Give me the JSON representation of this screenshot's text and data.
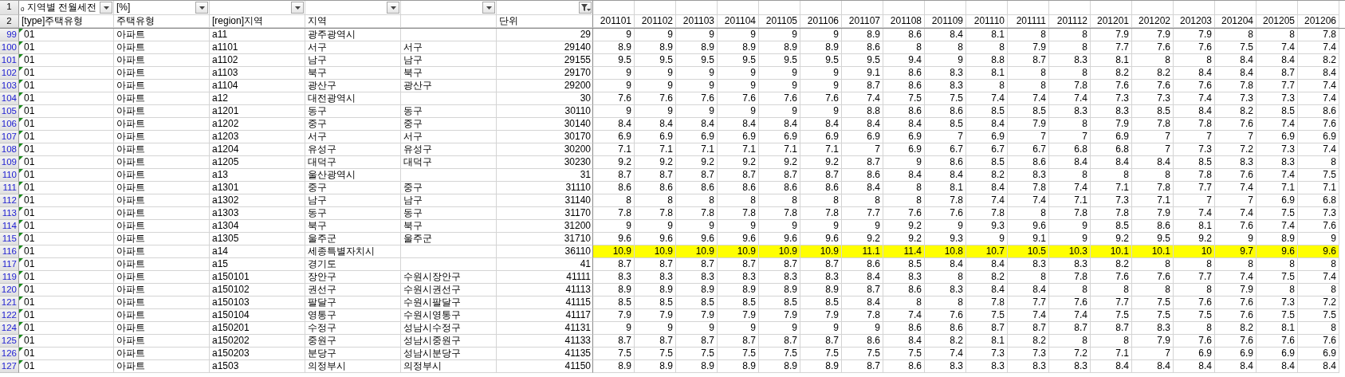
{
  "title_row": {
    "row_number": "1",
    "title": "ₒ 지역별 전월세전",
    "unit_note": "[%]",
    "filters": [
      {
        "active": false
      },
      {
        "active": false
      },
      {
        "active": false
      },
      {
        "active": false
      },
      {
        "active": false
      },
      {
        "active": true
      }
    ]
  },
  "header_row": {
    "row_number": "2",
    "type_code": "[type]주택유형",
    "type": "주택유형",
    "region_code": "[region]지역",
    "region": "지역",
    "unit": "단위",
    "months": [
      "201101",
      "201102",
      "201103",
      "201104",
      "201105",
      "201106",
      "201107",
      "201108",
      "201109",
      "201110",
      "201111",
      "201112",
      "201201",
      "201202",
      "201203",
      "201204",
      "201205",
      "201206"
    ]
  },
  "rows": [
    {
      "row_number": "99",
      "type_code": "01",
      "type": "아파트",
      "code": "a11",
      "region": "광주광역시",
      "unit": "29",
      "highlighted": false,
      "values": [
        "9",
        "9",
        "9",
        "9",
        "9",
        "9",
        "8.9",
        "8.6",
        "8.4",
        "8.1",
        "8",
        "8",
        "7.9",
        "7.9",
        "7.9",
        "8",
        "8",
        "7.8"
      ]
    },
    {
      "row_number": "100",
      "type_code": "01",
      "type": "아파트",
      "code": "a1101",
      "region": "서구",
      "region_full": "서구",
      "unit": "29140",
      "highlighted": false,
      "values": [
        "8.9",
        "8.9",
        "8.9",
        "8.9",
        "8.9",
        "8.9",
        "8.6",
        "8",
        "8",
        "8",
        "7.9",
        "8",
        "7.7",
        "7.6",
        "7.6",
        "7.5",
        "7.4",
        "7.4"
      ]
    },
    {
      "row_number": "101",
      "type_code": "01",
      "type": "아파트",
      "code": "a1102",
      "region": "남구",
      "region_full": "남구",
      "unit": "29155",
      "highlighted": false,
      "values": [
        "9.5",
        "9.5",
        "9.5",
        "9.5",
        "9.5",
        "9.5",
        "9.5",
        "9.4",
        "9",
        "8.8",
        "8.7",
        "8.3",
        "8.1",
        "8",
        "8",
        "8.4",
        "8.4",
        "8.2"
      ]
    },
    {
      "row_number": "102",
      "type_code": "01",
      "type": "아파트",
      "code": "a1103",
      "region": "북구",
      "region_full": "북구",
      "unit": "29170",
      "highlighted": false,
      "values": [
        "9",
        "9",
        "9",
        "9",
        "9",
        "9",
        "9.1",
        "8.6",
        "8.3",
        "8.1",
        "8",
        "8",
        "8.2",
        "8.2",
        "8.4",
        "8.4",
        "8.7",
        "8.4"
      ]
    },
    {
      "row_number": "103",
      "type_code": "01",
      "type": "아파트",
      "code": "a1104",
      "region": "광산구",
      "region_full": "광산구",
      "unit": "29200",
      "highlighted": false,
      "values": [
        "9",
        "9",
        "9",
        "9",
        "9",
        "9",
        "8.7",
        "8.6",
        "8.3",
        "8",
        "8",
        "7.8",
        "7.6",
        "7.6",
        "7.6",
        "7.8",
        "7.7",
        "7.4"
      ]
    },
    {
      "row_number": "104",
      "type_code": "01",
      "type": "아파트",
      "code": "a12",
      "region": "대전광역시",
      "unit": "30",
      "highlighted": false,
      "values": [
        "7.6",
        "7.6",
        "7.6",
        "7.6",
        "7.6",
        "7.6",
        "7.4",
        "7.5",
        "7.5",
        "7.4",
        "7.4",
        "7.4",
        "7.3",
        "7.3",
        "7.4",
        "7.3",
        "7.3",
        "7.4"
      ]
    },
    {
      "row_number": "105",
      "type_code": "01",
      "type": "아파트",
      "code": "a1201",
      "region": "동구",
      "region_full": "동구",
      "unit": "30110",
      "highlighted": false,
      "values": [
        "9",
        "9",
        "9",
        "9",
        "9",
        "9",
        "8.8",
        "8.6",
        "8.6",
        "8.5",
        "8.5",
        "8.3",
        "8.3",
        "8.5",
        "8.4",
        "8.2",
        "8.5",
        "8.6"
      ]
    },
    {
      "row_number": "106",
      "type_code": "01",
      "type": "아파트",
      "code": "a1202",
      "region": "중구",
      "region_full": "중구",
      "unit": "30140",
      "highlighted": false,
      "values": [
        "8.4",
        "8.4",
        "8.4",
        "8.4",
        "8.4",
        "8.4",
        "8.4",
        "8.4",
        "8.5",
        "8.4",
        "7.9",
        "8",
        "7.9",
        "7.8",
        "7.8",
        "7.6",
        "7.4",
        "7.6"
      ]
    },
    {
      "row_number": "107",
      "type_code": "01",
      "type": "아파트",
      "code": "a1203",
      "region": "서구",
      "region_full": "서구",
      "unit": "30170",
      "highlighted": false,
      "values": [
        "6.9",
        "6.9",
        "6.9",
        "6.9",
        "6.9",
        "6.9",
        "6.9",
        "6.9",
        "7",
        "6.9",
        "7",
        "7",
        "6.9",
        "7",
        "7",
        "7",
        "6.9",
        "6.9"
      ]
    },
    {
      "row_number": "108",
      "type_code": "01",
      "type": "아파트",
      "code": "a1204",
      "region": "유성구",
      "region_full": "유성구",
      "unit": "30200",
      "highlighted": false,
      "values": [
        "7.1",
        "7.1",
        "7.1",
        "7.1",
        "7.1",
        "7.1",
        "7",
        "6.9",
        "6.7",
        "6.7",
        "6.7",
        "6.8",
        "6.8",
        "7",
        "7.3",
        "7.2",
        "7.3",
        "7.4"
      ]
    },
    {
      "row_number": "109",
      "type_code": "01",
      "type": "아파트",
      "code": "a1205",
      "region": "대덕구",
      "region_full": "대덕구",
      "unit": "30230",
      "highlighted": false,
      "values": [
        "9.2",
        "9.2",
        "9.2",
        "9.2",
        "9.2",
        "9.2",
        "8.7",
        "9",
        "8.6",
        "8.5",
        "8.6",
        "8.4",
        "8.4",
        "8.4",
        "8.5",
        "8.3",
        "8.3",
        "8"
      ]
    },
    {
      "row_number": "110",
      "type_code": "01",
      "type": "아파트",
      "code": "a13",
      "region": "울산광역시",
      "unit": "31",
      "highlighted": false,
      "values": [
        "8.7",
        "8.7",
        "8.7",
        "8.7",
        "8.7",
        "8.7",
        "8.6",
        "8.4",
        "8.4",
        "8.2",
        "8.3",
        "8",
        "8",
        "8",
        "7.8",
        "7.6",
        "7.4",
        "7.5"
      ]
    },
    {
      "row_number": "111",
      "type_code": "01",
      "type": "아파트",
      "code": "a1301",
      "region": "중구",
      "region_full": "중구",
      "unit": "31110",
      "highlighted": false,
      "values": [
        "8.6",
        "8.6",
        "8.6",
        "8.6",
        "8.6",
        "8.6",
        "8.4",
        "8",
        "8.1",
        "8.4",
        "7.8",
        "7.4",
        "7.1",
        "7.8",
        "7.7",
        "7.4",
        "7.1",
        "7.1"
      ]
    },
    {
      "row_number": "112",
      "type_code": "01",
      "type": "아파트",
      "code": "a1302",
      "region": "남구",
      "region_full": "남구",
      "unit": "31140",
      "highlighted": false,
      "values": [
        "8",
        "8",
        "8",
        "8",
        "8",
        "8",
        "8",
        "8",
        "7.8",
        "7.4",
        "7.4",
        "7.1",
        "7.3",
        "7.1",
        "7",
        "7",
        "6.9",
        "6.8"
      ]
    },
    {
      "row_number": "113",
      "type_code": "01",
      "type": "아파트",
      "code": "a1303",
      "region": "동구",
      "region_full": "동구",
      "unit": "31170",
      "highlighted": false,
      "values": [
        "7.8",
        "7.8",
        "7.8",
        "7.8",
        "7.8",
        "7.8",
        "7.7",
        "7.6",
        "7.6",
        "7.8",
        "8",
        "7.8",
        "7.8",
        "7.9",
        "7.4",
        "7.4",
        "7.5",
        "7.3"
      ]
    },
    {
      "row_number": "114",
      "type_code": "01",
      "type": "아파트",
      "code": "a1304",
      "region": "북구",
      "region_full": "북구",
      "unit": "31200",
      "highlighted": false,
      "values": [
        "9",
        "9",
        "9",
        "9",
        "9",
        "9",
        "9",
        "9.2",
        "9",
        "9.3",
        "9.6",
        "9",
        "8.5",
        "8.6",
        "8.1",
        "7.6",
        "7.4",
        "7.6"
      ]
    },
    {
      "row_number": "115",
      "type_code": "01",
      "type": "아파트",
      "code": "a1305",
      "region": "울주군",
      "region_full": "울주군",
      "unit": "31710",
      "highlighted": false,
      "values": [
        "9.6",
        "9.6",
        "9.6",
        "9.6",
        "9.6",
        "9.6",
        "9.2",
        "9.2",
        "9.3",
        "9",
        "9.1",
        "9",
        "9.2",
        "9.5",
        "9.2",
        "9",
        "8.9",
        "9"
      ]
    },
    {
      "row_number": "116",
      "type_code": "01",
      "type": "아파트",
      "code": "a14",
      "region": "세종특별자치시",
      "unit": "36110",
      "highlighted": true,
      "values": [
        "10.9",
        "10.9",
        "10.9",
        "10.9",
        "10.9",
        "10.9",
        "11.1",
        "11.4",
        "10.8",
        "10.7",
        "10.5",
        "10.3",
        "10.1",
        "10.1",
        "10",
        "9.7",
        "9.6",
        "9.6"
      ]
    },
    {
      "row_number": "117",
      "type_code": "01",
      "type": "아파트",
      "code": "a15",
      "region": "경기도",
      "unit": "41",
      "highlighted": false,
      "values": [
        "8.7",
        "8.7",
        "8.7",
        "8.7",
        "8.7",
        "8.7",
        "8.6",
        "8.5",
        "8.4",
        "8.4",
        "8.3",
        "8.3",
        "8.2",
        "8",
        "8",
        "8",
        "8",
        "8"
      ]
    },
    {
      "row_number": "119",
      "type_code": "01",
      "type": "아파트",
      "code": "a150101",
      "region": "장안구",
      "region_full": "수원시장안구",
      "unit": "41111",
      "highlighted": false,
      "values": [
        "8.3",
        "8.3",
        "8.3",
        "8.3",
        "8.3",
        "8.3",
        "8.4",
        "8.3",
        "8",
        "8.2",
        "8",
        "7.8",
        "7.6",
        "7.6",
        "7.7",
        "7.4",
        "7.5",
        "7.4"
      ]
    },
    {
      "row_number": "120",
      "type_code": "01",
      "type": "아파트",
      "code": "a150102",
      "region": "권선구",
      "region_full": "수원시권선구",
      "unit": "41113",
      "highlighted": false,
      "values": [
        "8.9",
        "8.9",
        "8.9",
        "8.9",
        "8.9",
        "8.9",
        "8.7",
        "8.6",
        "8.3",
        "8.4",
        "8.4",
        "8",
        "8",
        "8",
        "8",
        "7.9",
        "8",
        "8"
      ]
    },
    {
      "row_number": "121",
      "type_code": "01",
      "type": "아파트",
      "code": "a150103",
      "region": "팔달구",
      "region_full": "수원시팔달구",
      "unit": "41115",
      "highlighted": false,
      "values": [
        "8.5",
        "8.5",
        "8.5",
        "8.5",
        "8.5",
        "8.5",
        "8.4",
        "8",
        "8",
        "7.8",
        "7.7",
        "7.6",
        "7.7",
        "7.5",
        "7.6",
        "7.6",
        "7.3",
        "7.2"
      ]
    },
    {
      "row_number": "122",
      "type_code": "01",
      "type": "아파트",
      "code": "a150104",
      "region": "영통구",
      "region_full": "수원시영통구",
      "unit": "41117",
      "highlighted": false,
      "values": [
        "7.9",
        "7.9",
        "7.9",
        "7.9",
        "7.9",
        "7.9",
        "7.8",
        "7.4",
        "7.6",
        "7.5",
        "7.4",
        "7.4",
        "7.5",
        "7.5",
        "7.5",
        "7.6",
        "7.5",
        "7.5"
      ]
    },
    {
      "row_number": "124",
      "type_code": "01",
      "type": "아파트",
      "code": "a150201",
      "region": "수정구",
      "region_full": "성남시수정구",
      "unit": "41131",
      "highlighted": false,
      "values": [
        "9",
        "9",
        "9",
        "9",
        "9",
        "9",
        "9",
        "8.6",
        "8.6",
        "8.7",
        "8.7",
        "8.7",
        "8.7",
        "8.3",
        "8",
        "8.2",
        "8.1",
        "8"
      ]
    },
    {
      "row_number": "125",
      "type_code": "01",
      "type": "아파트",
      "code": "a150202",
      "region": "중원구",
      "region_full": "성남시중원구",
      "unit": "41133",
      "highlighted": false,
      "values": [
        "8.7",
        "8.7",
        "8.7",
        "8.7",
        "8.7",
        "8.7",
        "8.6",
        "8.4",
        "8.2",
        "8.1",
        "8.2",
        "8",
        "8",
        "7.9",
        "7.6",
        "7.6",
        "7.6",
        "7.6"
      ]
    },
    {
      "row_number": "126",
      "type_code": "01",
      "type": "아파트",
      "code": "a150203",
      "region": "분당구",
      "region_full": "성남시분당구",
      "unit": "41135",
      "highlighted": false,
      "values": [
        "7.5",
        "7.5",
        "7.5",
        "7.5",
        "7.5",
        "7.5",
        "7.5",
        "7.5",
        "7.4",
        "7.3",
        "7.3",
        "7.2",
        "7.1",
        "7",
        "6.9",
        "6.9",
        "6.9",
        "6.9"
      ]
    },
    {
      "row_number": "127",
      "type_code": "01",
      "type": "아파트",
      "code": "a1503",
      "region": "의정부시",
      "region_full": "의정부시",
      "unit": "41150",
      "highlighted": false,
      "values": [
        "8.9",
        "8.9",
        "8.9",
        "8.9",
        "8.9",
        "8.9",
        "8.7",
        "8.6",
        "8.3",
        "8.3",
        "8.3",
        "8.3",
        "8.4",
        "8.4",
        "8.4",
        "8.4",
        "8.4",
        "8.4"
      ]
    }
  ]
}
